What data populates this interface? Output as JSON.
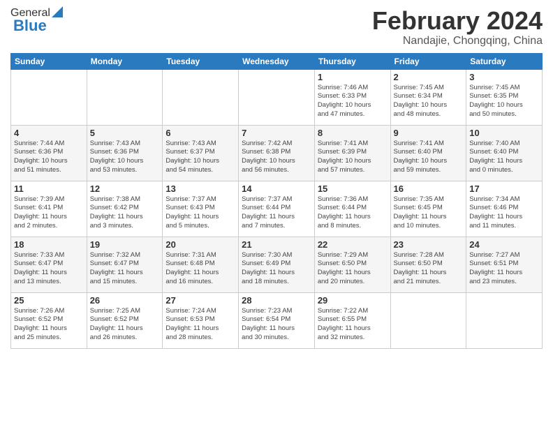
{
  "header": {
    "logo_general": "General",
    "logo_blue": "Blue",
    "month_title": "February 2024",
    "location": "Nandajie, Chongqing, China"
  },
  "weekdays": [
    "Sunday",
    "Monday",
    "Tuesday",
    "Wednesday",
    "Thursday",
    "Friday",
    "Saturday"
  ],
  "weeks": [
    [
      {
        "day": "",
        "info": ""
      },
      {
        "day": "",
        "info": ""
      },
      {
        "day": "",
        "info": ""
      },
      {
        "day": "",
        "info": ""
      },
      {
        "day": "1",
        "info": "Sunrise: 7:46 AM\nSunset: 6:33 PM\nDaylight: 10 hours\nand 47 minutes."
      },
      {
        "day": "2",
        "info": "Sunrise: 7:45 AM\nSunset: 6:34 PM\nDaylight: 10 hours\nand 48 minutes."
      },
      {
        "day": "3",
        "info": "Sunrise: 7:45 AM\nSunset: 6:35 PM\nDaylight: 10 hours\nand 50 minutes."
      }
    ],
    [
      {
        "day": "4",
        "info": "Sunrise: 7:44 AM\nSunset: 6:36 PM\nDaylight: 10 hours\nand 51 minutes."
      },
      {
        "day": "5",
        "info": "Sunrise: 7:43 AM\nSunset: 6:36 PM\nDaylight: 10 hours\nand 53 minutes."
      },
      {
        "day": "6",
        "info": "Sunrise: 7:43 AM\nSunset: 6:37 PM\nDaylight: 10 hours\nand 54 minutes."
      },
      {
        "day": "7",
        "info": "Sunrise: 7:42 AM\nSunset: 6:38 PM\nDaylight: 10 hours\nand 56 minutes."
      },
      {
        "day": "8",
        "info": "Sunrise: 7:41 AM\nSunset: 6:39 PM\nDaylight: 10 hours\nand 57 minutes."
      },
      {
        "day": "9",
        "info": "Sunrise: 7:41 AM\nSunset: 6:40 PM\nDaylight: 10 hours\nand 59 minutes."
      },
      {
        "day": "10",
        "info": "Sunrise: 7:40 AM\nSunset: 6:40 PM\nDaylight: 11 hours\nand 0 minutes."
      }
    ],
    [
      {
        "day": "11",
        "info": "Sunrise: 7:39 AM\nSunset: 6:41 PM\nDaylight: 11 hours\nand 2 minutes."
      },
      {
        "day": "12",
        "info": "Sunrise: 7:38 AM\nSunset: 6:42 PM\nDaylight: 11 hours\nand 3 minutes."
      },
      {
        "day": "13",
        "info": "Sunrise: 7:37 AM\nSunset: 6:43 PM\nDaylight: 11 hours\nand 5 minutes."
      },
      {
        "day": "14",
        "info": "Sunrise: 7:37 AM\nSunset: 6:44 PM\nDaylight: 11 hours\nand 7 minutes."
      },
      {
        "day": "15",
        "info": "Sunrise: 7:36 AM\nSunset: 6:44 PM\nDaylight: 11 hours\nand 8 minutes."
      },
      {
        "day": "16",
        "info": "Sunrise: 7:35 AM\nSunset: 6:45 PM\nDaylight: 11 hours\nand 10 minutes."
      },
      {
        "day": "17",
        "info": "Sunrise: 7:34 AM\nSunset: 6:46 PM\nDaylight: 11 hours\nand 11 minutes."
      }
    ],
    [
      {
        "day": "18",
        "info": "Sunrise: 7:33 AM\nSunset: 6:47 PM\nDaylight: 11 hours\nand 13 minutes."
      },
      {
        "day": "19",
        "info": "Sunrise: 7:32 AM\nSunset: 6:47 PM\nDaylight: 11 hours\nand 15 minutes."
      },
      {
        "day": "20",
        "info": "Sunrise: 7:31 AM\nSunset: 6:48 PM\nDaylight: 11 hours\nand 16 minutes."
      },
      {
        "day": "21",
        "info": "Sunrise: 7:30 AM\nSunset: 6:49 PM\nDaylight: 11 hours\nand 18 minutes."
      },
      {
        "day": "22",
        "info": "Sunrise: 7:29 AM\nSunset: 6:50 PM\nDaylight: 11 hours\nand 20 minutes."
      },
      {
        "day": "23",
        "info": "Sunrise: 7:28 AM\nSunset: 6:50 PM\nDaylight: 11 hours\nand 21 minutes."
      },
      {
        "day": "24",
        "info": "Sunrise: 7:27 AM\nSunset: 6:51 PM\nDaylight: 11 hours\nand 23 minutes."
      }
    ],
    [
      {
        "day": "25",
        "info": "Sunrise: 7:26 AM\nSunset: 6:52 PM\nDaylight: 11 hours\nand 25 minutes."
      },
      {
        "day": "26",
        "info": "Sunrise: 7:25 AM\nSunset: 6:52 PM\nDaylight: 11 hours\nand 26 minutes."
      },
      {
        "day": "27",
        "info": "Sunrise: 7:24 AM\nSunset: 6:53 PM\nDaylight: 11 hours\nand 28 minutes."
      },
      {
        "day": "28",
        "info": "Sunrise: 7:23 AM\nSunset: 6:54 PM\nDaylight: 11 hours\nand 30 minutes."
      },
      {
        "day": "29",
        "info": "Sunrise: 7:22 AM\nSunset: 6:55 PM\nDaylight: 11 hours\nand 32 minutes."
      },
      {
        "day": "",
        "info": ""
      },
      {
        "day": "",
        "info": ""
      }
    ]
  ]
}
